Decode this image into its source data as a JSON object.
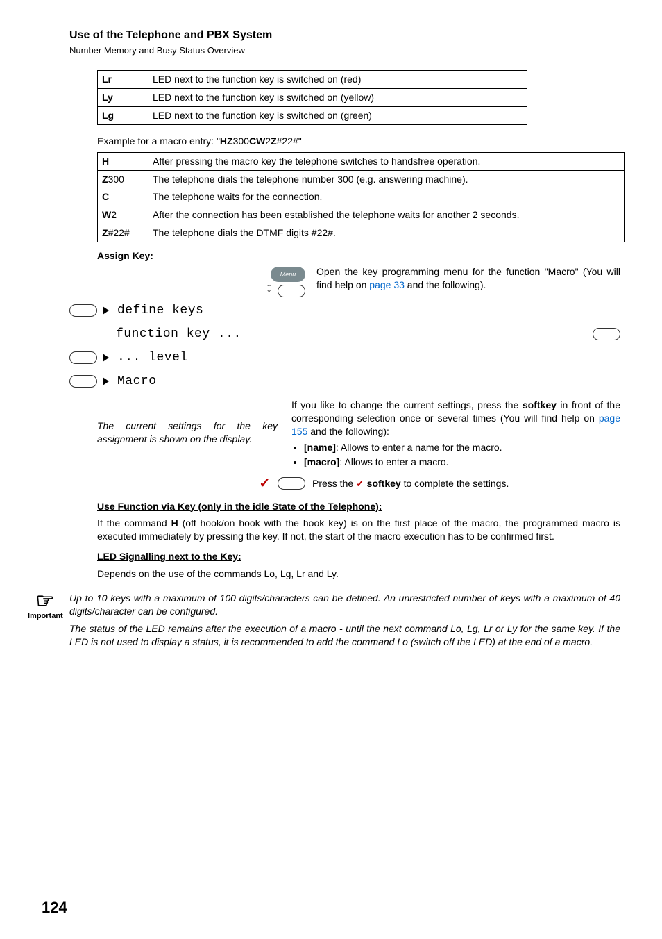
{
  "header": {
    "title": "Use of the Telephone and PBX System",
    "subtitle": "Number Memory and Busy Status Overview"
  },
  "led_table": [
    {
      "code": "Lr",
      "desc": "LED next to the function key is switched on (red)"
    },
    {
      "code": "Ly",
      "desc": "LED next to the function key is switched on (yellow)"
    },
    {
      "code": "Lg",
      "desc": "LED next to the function key is switched on (green)"
    }
  ],
  "example_intro_a": "Example for a macro entry: \"",
  "example_intro_b": "HZ",
  "example_intro_c": "300",
  "example_intro_d": "CW",
  "example_intro_e": "2",
  "example_intro_f": "Z",
  "example_intro_g": "#22#\"",
  "macro_table": [
    {
      "code": "H",
      "desc": "After pressing the macro key the telephone switches to handsfree operation."
    },
    {
      "code": "Z300",
      "desc": "The telephone dials the telephone number 300 (e.g. answering machine)."
    },
    {
      "code": "C",
      "desc": "The telephone waits for the connection."
    },
    {
      "code": "W2",
      "desc": "After the connection has been established the telephone waits for another 2 seconds."
    },
    {
      "code": "Z#22#",
      "desc": "The telephone dials the DTMF digits #22#."
    }
  ],
  "macro_cells": {
    "Z300_bold": "Z",
    "Z300_rest": "300",
    "W2_bold": "W",
    "W2_rest": "2",
    "Z22_bold": "Z",
    "Z22_rest": "#22#"
  },
  "assign_key": "Assign Key:",
  "menu_label": "Menu",
  "open_text_a": "Open the key programming menu for the function \"Macro\" (You will find help on ",
  "open_link": "page 33",
  "open_text_b": " and the following).",
  "lcd": {
    "define": "define keys",
    "function": "function key ...",
    "level": "... level",
    "macro": "Macro"
  },
  "current_settings": "The current settings for the key assignment is shown on the display.",
  "change_a": "If you like to change the current settings, press the ",
  "change_b": "softkey",
  "change_c": " in front of the corresponding selection once or several times (You will find help on ",
  "change_link": "page 155",
  "change_d": " and the following):",
  "bullet1_b": "[name]",
  "bullet1_t": ": Allows to enter a name for the macro.",
  "bullet2_b": "[macro]",
  "bullet2_t": ": Allows to enter a macro.",
  "press_a": "Press the ",
  "press_b": " softkey",
  "press_c": " to complete the settings.",
  "use_head": "Use Function via Key (only in the idle State of the Telephone):",
  "use_body_a": "If the command ",
  "use_body_h": "H",
  "use_body_b": " (off hook/on hook with the hook key) is on the first place of the macro, the programmed macro is executed immediately by pressing the key. If not, the start of the macro execution has to be confirmed first.",
  "led_head": "LED Signalling next to the Key:",
  "led_body": "Depends on the use of the commands Lo, Lg, Lr and Ly.",
  "important_label": "Important",
  "important1": "Up to 10 keys with a maximum of 100 digits/characters can be defined. An unrestricted number of keys with a maximum of 40 digits/character can be configured.",
  "important2": "The status of the LED remains after the execution of a macro - until the next command Lo, Lg, Lr or Ly for the same key. If the LED is not used to display a status, it is recommended to add the command Lo (switch off the LED) at the end of a macro.",
  "page": "124"
}
